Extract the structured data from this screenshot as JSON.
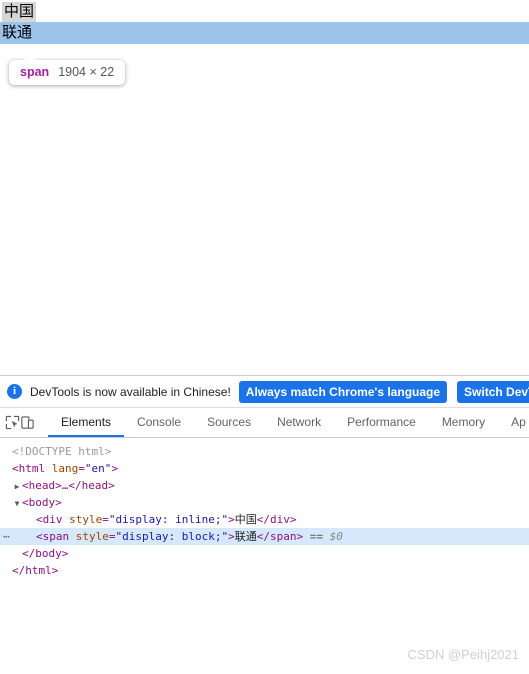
{
  "page": {
    "div_text": "中国",
    "span_text": "联通",
    "div_highlight_color": "#d6d6d6",
    "span_highlight_color": "#9cc3ea"
  },
  "inspect_tooltip": {
    "tag": "span",
    "dimensions": "1904 × 22"
  },
  "devtools": {
    "banner": {
      "icon": "info-icon",
      "icon_glyph": "i",
      "message": "DevTools is now available in Chinese!",
      "primary_button": "Always match Chrome's language",
      "secondary_button": "Switch DevTools",
      "accent_color": "#1a73e8"
    },
    "toolbar_icons": [
      {
        "name": "inspect-element-icon"
      },
      {
        "name": "device-toolbar-icon"
      }
    ],
    "tabs": [
      {
        "label": "Elements",
        "active": true
      },
      {
        "label": "Console",
        "active": false
      },
      {
        "label": "Sources",
        "active": false
      },
      {
        "label": "Network",
        "active": false
      },
      {
        "label": "Performance",
        "active": false
      },
      {
        "label": "Memory",
        "active": false
      },
      {
        "label": "Ap",
        "active": false
      }
    ],
    "dom_tree": {
      "doctype": "<!DOCTYPE html>",
      "html_open_lt": "<",
      "html_tag": "html",
      "html_attr": "lang",
      "html_attr_eq": "=",
      "html_attr_val": "\"en\"",
      "html_open_gt": ">",
      "head_twisty": "▶",
      "head_line": "<head>…</head>",
      "body_twisty": "▼",
      "body_open": "<body>",
      "div_lt": "<",
      "div_tag": "div",
      "div_attr": "style",
      "div_attr_val": "\"display: inline;\"",
      "div_gt": ">",
      "div_text": "中国",
      "div_close": "</div>",
      "span_badge": "⋯",
      "span_lt": "<",
      "span_tag": "span",
      "span_attr": "style",
      "span_attr_val": "\"display: block;\"",
      "span_gt": ">",
      "span_text": "联通",
      "span_close": "</span>",
      "span_eq": "==",
      "span_dollar": "$0",
      "body_close": "</body>",
      "html_close": "</html>"
    }
  },
  "watermark": "CSDN @Peihj2021"
}
